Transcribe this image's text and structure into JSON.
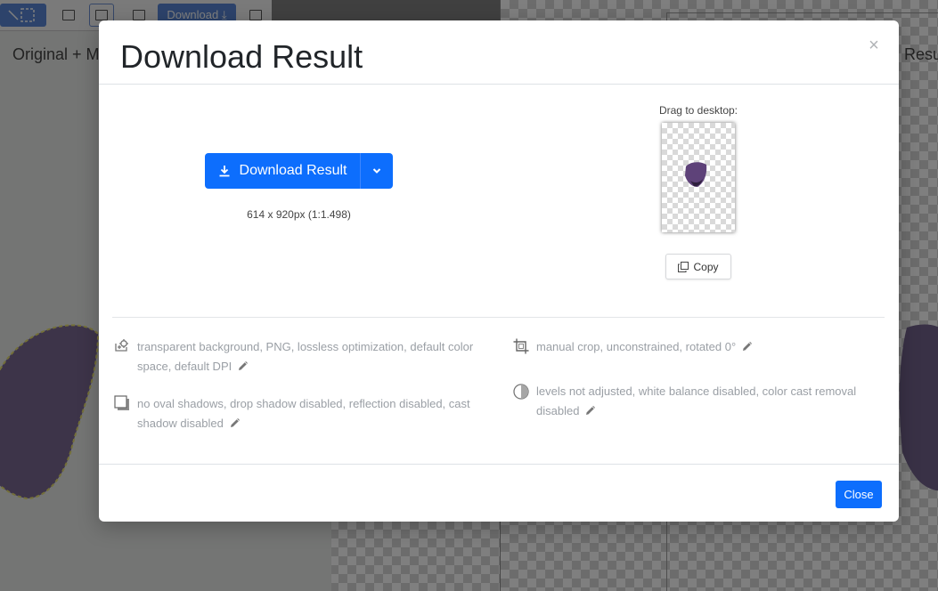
{
  "background": {
    "toolbar": {
      "download_label": "Download ⤓"
    },
    "left_pane_label": "Original + M",
    "right_pane_label": "Resu"
  },
  "modal": {
    "title": "Download Result",
    "close_symbol": "×",
    "download_button_label": "Download Result",
    "dimensions_text": "614 x 920px (1:1.498)",
    "drag_label": "Drag to desktop:",
    "copy_label": "Copy",
    "options": {
      "output": "transparent background, PNG, lossless optimization, default color space, default DPI",
      "shadows": "no oval shadows, drop shadow disabled, reflection disabled, cast shadow disabled",
      "crop": "manual crop, unconstrained, rotated 0°",
      "color": "levels not adjusted, white balance disabled, color cast removal disabled"
    },
    "footer_close_label": "Close"
  },
  "icons": {
    "download": "download-icon",
    "chevron": "chevron-down-icon",
    "copy": "copy-icon",
    "pencil": "pencil-icon",
    "output": "output-settings-icon",
    "shadow": "shadow-icon",
    "crop": "crop-icon",
    "color": "color-adjust-icon"
  },
  "colors": {
    "primary": "#0d6efd",
    "muted_text": "#9a9fa5",
    "petal": "#6a4d89"
  }
}
